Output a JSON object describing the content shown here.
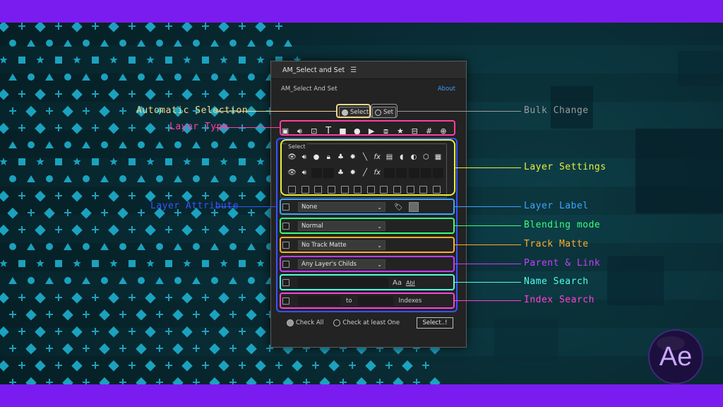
{
  "colors": {
    "top_bar": "#7a1cf0",
    "bottom_bar": "#7a1cf0",
    "pattern_icon": "#1fb8d8",
    "panel_bg": "#232323",
    "auto_selection": "#f0d78a",
    "layer_type": "#ff3ea0",
    "layer_settings": "#e9ef3a",
    "layer_attribute": "#3455ff",
    "layer_label": "#3aa6ff",
    "blending_mode": "#38ff7a",
    "track_matte": "#ffae2a",
    "parent_link": "#c040ff",
    "name_search": "#4dffe6",
    "index_search": "#ff40d8",
    "bulk_change": "#9a9a9a"
  },
  "panel": {
    "tab_title": "AM_Select and Set",
    "menu_icon": "hamburger-icon",
    "subtitle": "AM_Select And Set",
    "about_link": "About",
    "mode_select": "Select",
    "mode_set": "Set",
    "type_icons": [
      "image-icon",
      "audio-icon",
      "comp-icon",
      "text-icon",
      "solid-icon",
      "light-icon",
      "camera-icon",
      "null-icon",
      "shape-icon",
      "adjustment-icon",
      "guide-icon",
      "3d-icon"
    ],
    "select_group_label": "Select",
    "settings_row1": [
      "eye-icon",
      "audio-icon",
      "solo-icon",
      "lock-icon",
      "shy-icon",
      "collapse-icon",
      "quality-icon",
      "fx-icon",
      "frame-blend-icon",
      "motion-blur-icon",
      "adjustment-icon",
      "3d-icon",
      "grid-icon"
    ],
    "settings_row2": [
      "eye-icon",
      "audio-icon",
      "blank",
      "blank",
      "shy-icon",
      "collapse-icon",
      "quality-icon",
      "fx-icon",
      "blank",
      "blank",
      "blank",
      "blank",
      "blank"
    ],
    "label_dropdown": "None",
    "label_icon": "tag-icon",
    "blending_dropdown": "Normal",
    "track_matte_dropdown": "No Track Matte",
    "parent_dropdown": "Any Layer's Childs",
    "name_match_case": "Aa",
    "name_whole_word": "Abl",
    "index_to": "to",
    "index_label": "Indexes",
    "check_all": "Check All",
    "check_at_least_one": "Check at least One",
    "select_button": "Select..!"
  },
  "callouts": {
    "automatic_selection": "Automatic Selection",
    "layer_type": "Layer Type",
    "layer_attribute": "Layer Attribute",
    "bulk_change": "Bulk Change",
    "layer_settings": "Layer Settings",
    "layer_label": "Layer Label",
    "blending_mode": "Blending mode",
    "track_matte": "Track Matte",
    "parent_link": "Parent & Link",
    "name_search": "Name Search",
    "index_search": "Index Search"
  },
  "logo": {
    "text": "Ae"
  }
}
